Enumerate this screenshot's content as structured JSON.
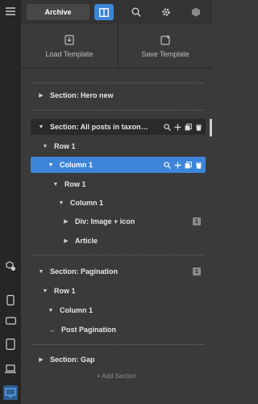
{
  "topbar": {
    "archive_tab": "Archive"
  },
  "templates": {
    "load_label": "Load Template",
    "save_label": "Save Template"
  },
  "tree": [
    {
      "label": "Section: Hero new",
      "caret": "right"
    },
    {
      "label": "Section: All posts in taxon…",
      "caret": "down"
    },
    {
      "label": "Row 1",
      "caret": "down"
    },
    {
      "label": "Column 1",
      "caret": "down"
    },
    {
      "label": "Row 1",
      "caret": "down"
    },
    {
      "label": "Column 1",
      "caret": "down"
    },
    {
      "label": "Div: Image + icon",
      "caret": "right",
      "badge": "1"
    },
    {
      "label": "Article",
      "caret": "right"
    },
    {
      "label": "Section: Pagination",
      "caret": "down",
      "badge": "1"
    },
    {
      "label": "Row 1",
      "caret": "down"
    },
    {
      "label": "Column 1",
      "caret": "down"
    },
    {
      "label": "Post Pagination",
      "caret": "none"
    },
    {
      "label": "Section: Gap",
      "caret": "right"
    }
  ],
  "add_section_label": "+ Add Section",
  "colors": {
    "accent": "#3d85d8",
    "panel": "#3a3a3a",
    "rail": "#262626"
  }
}
